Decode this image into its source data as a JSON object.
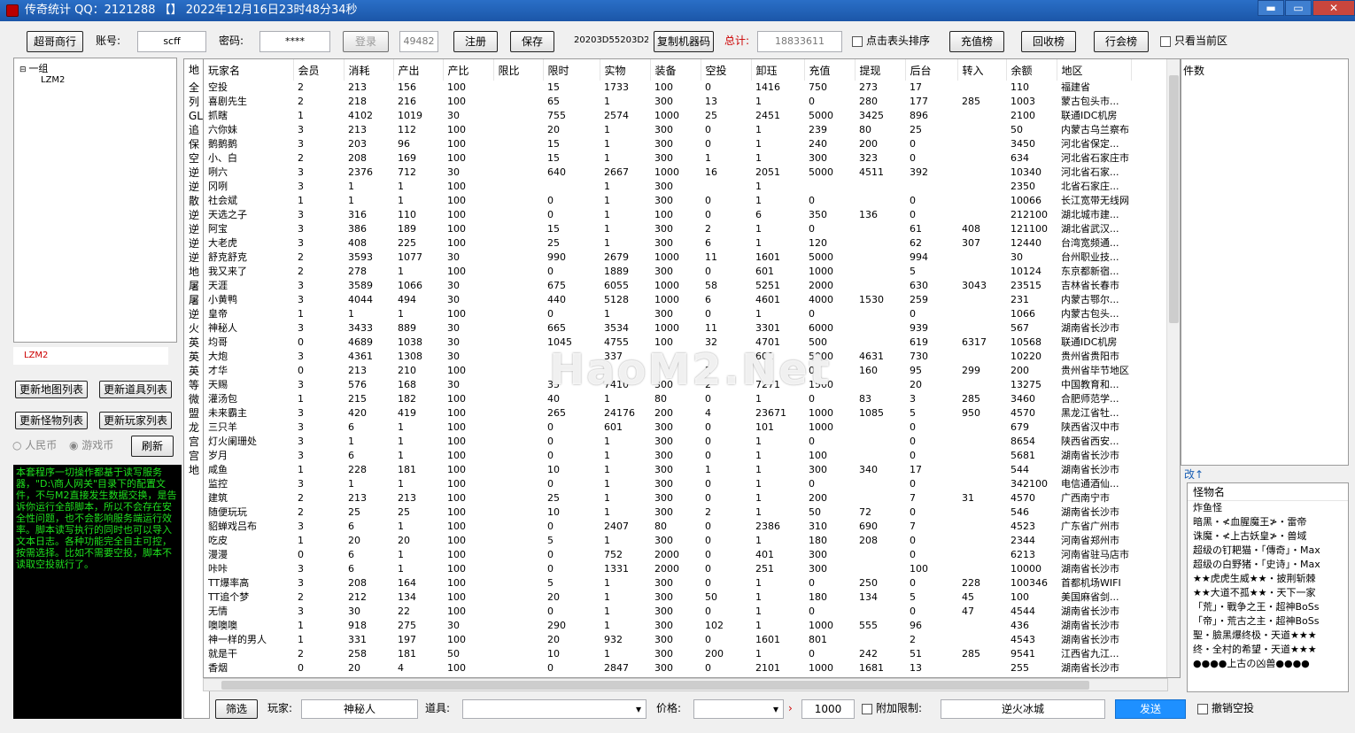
{
  "window": {
    "title": "传奇统计 QQ：2121288 【】 2022年12月16日23时48分34秒",
    "min": "▬",
    "max": "▭",
    "close": "✕"
  },
  "toolbar": {
    "mode_button": "超哥商行",
    "account_label": "账号:",
    "account_value": "scff",
    "password_label": "密码:",
    "password_value": "****",
    "login": "登录",
    "port": "49482",
    "register": "注册",
    "save": "保存",
    "machine_code": "20203D55203D2",
    "copy_machine_code": "复制机器码",
    "total_label": "总计:",
    "total_value": "18833611",
    "sort_by_header": "点击表头排序",
    "recharge_rank": "充值榜",
    "recycle_rank": "回收榜",
    "guild_rank": "行会榜",
    "current_area_only": "只看当前区"
  },
  "tree": {
    "group": "一组",
    "child": "LZM2"
  },
  "left": {
    "server_name": "LZM2",
    "update_map": "更新地图列表",
    "update_item": "更新道具列表",
    "update_monster": "更新怪物列表",
    "update_player": "更新玩家列表",
    "rmb_label": "人民币",
    "game_coin_label": "游戏币",
    "refresh": "刷新",
    "console_text": "本套程序一切操作都基于读写服务器，\"D:\\商人网关\"目录下的配置文件，不与M2直接发生数据交换，是告诉你运行全部脚本，所以不会存在安全性问题，也不会影响服务端运行效率。脚本读写执行的同时也可以导入文本日志。各种功能完全自主可控，按需选择。比如不需要空投，脚本不读取空投就行了。"
  },
  "maps": [
    "地",
    "全",
    "列",
    "GL",
    "追",
    "保",
    "空",
    "逆",
    "逆",
    "散",
    "逆",
    "逆",
    "逆",
    "逆",
    "地",
    "屠",
    "屠",
    "逆",
    "火",
    "英",
    "英",
    "英",
    "等",
    "微",
    "盟",
    "龙",
    "宫",
    "宫",
    "地"
  ],
  "headers": [
    "玩家名",
    "会员",
    "消耗",
    "产出",
    "产比",
    "限比",
    "限时",
    "实物",
    "装备",
    "空投",
    "卸珏",
    "充值",
    "提现",
    "后台",
    "转入",
    "余额",
    "地区"
  ],
  "rows": [
    [
      "空投",
      "2",
      "213",
      "156",
      "100",
      "",
      "15",
      "1733",
      "100",
      "0",
      "1416",
      "750",
      "273",
      "17",
      "",
      "110",
      "福建省"
    ],
    [
      "喜剧先生",
      "2",
      "218",
      "216",
      "100",
      "",
      "65",
      "1",
      "300",
      "13",
      "1",
      "0",
      "280",
      "177",
      "285",
      "1003",
      "蒙古包头市..."
    ],
    [
      "抓瞎",
      "1",
      "4102",
      "1019",
      "30",
      "",
      "755",
      "2574",
      "1000",
      "25",
      "2451",
      "5000",
      "3425",
      "896",
      "",
      "2100",
      "联通IDC机房"
    ],
    [
      "六你妹",
      "3",
      "213",
      "112",
      "100",
      "",
      "20",
      "1",
      "300",
      "0",
      "1",
      "239",
      "80",
      "25",
      "",
      "50",
      "内蒙古乌兰察布"
    ],
    [
      "鹅鹅鹅",
      "3",
      "203",
      "96",
      "100",
      "",
      "15",
      "1",
      "300",
      "0",
      "1",
      "240",
      "200",
      "0",
      "",
      "3450",
      "河北省保定..."
    ],
    [
      "小、白",
      "2",
      "208",
      "169",
      "100",
      "",
      "15",
      "1",
      "300",
      "1",
      "1",
      "300",
      "323",
      "0",
      "",
      "634",
      "河北省石家庄市"
    ],
    [
      "咧六",
      "3",
      "2376",
      "712",
      "30",
      "",
      "640",
      "2667",
      "1000",
      "16",
      "2051",
      "5000",
      "4511",
      "392",
      "",
      "10340",
      "河北省石家..."
    ],
    [
      "冈咧",
      "3",
      "1",
      "1",
      "100",
      "",
      "",
      "1",
      "300",
      "",
      "1",
      "",
      "",
      "",
      "",
      "2350",
      "北省石家庄..."
    ],
    [
      "社会斌",
      "1",
      "1",
      "1",
      "100",
      "",
      "0",
      "1",
      "300",
      "0",
      "1",
      "0",
      "",
      "0",
      "",
      "10066",
      "长江宽带无线网"
    ],
    [
      "天选之子",
      "3",
      "316",
      "110",
      "100",
      "",
      "0",
      "1",
      "100",
      "0",
      "6",
      "350",
      "136",
      "0",
      "",
      "212100",
      "湖北城市建..."
    ],
    [
      "阿宝",
      "3",
      "386",
      "189",
      "100",
      "",
      "15",
      "1",
      "300",
      "2",
      "1",
      "0",
      "",
      "61",
      "408",
      "121100",
      "湖北省武汉..."
    ],
    [
      "大老虎",
      "3",
      "408",
      "225",
      "100",
      "",
      "25",
      "1",
      "300",
      "6",
      "1",
      "120",
      "",
      "62",
      "307",
      "12440",
      "台湾宽频通..."
    ],
    [
      "舒克舒克",
      "2",
      "3593",
      "1077",
      "30",
      "",
      "990",
      "2679",
      "1000",
      "11",
      "1601",
      "5000",
      "",
      "994",
      "",
      "30",
      "台州职业技..."
    ],
    [
      "我又来了",
      "2",
      "278",
      "1",
      "100",
      "",
      "0",
      "1889",
      "300",
      "0",
      "601",
      "1000",
      "",
      "5",
      "",
      "10124",
      "东京都新宿..."
    ],
    [
      "天涯",
      "3",
      "3589",
      "1066",
      "30",
      "",
      "675",
      "6055",
      "1000",
      "58",
      "5251",
      "2000",
      "",
      "630",
      "3043",
      "23515",
      "吉林省长春市"
    ],
    [
      "小黄鸭",
      "3",
      "4044",
      "494",
      "30",
      "",
      "440",
      "5128",
      "1000",
      "6",
      "4601",
      "4000",
      "1530",
      "259",
      "",
      "231",
      "内蒙古鄂尔..."
    ],
    [
      "皇帝",
      "1",
      "1",
      "1",
      "100",
      "",
      "0",
      "1",
      "300",
      "0",
      "1",
      "0",
      "",
      "0",
      "",
      "1066",
      "内蒙古包头..."
    ],
    [
      "神秘人",
      "3",
      "3433",
      "889",
      "30",
      "",
      "665",
      "3534",
      "1000",
      "11",
      "3301",
      "6000",
      "",
      "939",
      "",
      "567",
      "湖南省长沙市"
    ],
    [
      "均哥",
      "0",
      "4689",
      "1038",
      "30",
      "",
      "1045",
      "4755",
      "100",
      "32",
      "4701",
      "500",
      "",
      "619",
      "6317",
      "10568",
      "联通IDC机房"
    ],
    [
      "大炮",
      "3",
      "4361",
      "1308",
      "30",
      "",
      "",
      "337",
      "",
      "",
      "601",
      "5000",
      "4631",
      "730",
      "",
      "10220",
      "贵州省贵阳市"
    ],
    [
      "才华",
      "0",
      "213",
      "210",
      "100",
      "",
      "",
      "",
      "",
      "2",
      "",
      "0",
      "160",
      "95",
      "299",
      "200",
      "贵州省毕节地区"
    ],
    [
      "天赐",
      "3",
      "576",
      "168",
      "30",
      "",
      "35",
      "7410",
      "300",
      "2",
      "7271",
      "1500",
      "",
      "20",
      "",
      "13275",
      "中国教育和..."
    ],
    [
      "灌汤包",
      "1",
      "215",
      "182",
      "100",
      "",
      "40",
      "1",
      "80",
      "0",
      "1",
      "0",
      "83",
      "3",
      "285",
      "3460",
      "合肥师范学..."
    ],
    [
      "未来霸主",
      "3",
      "420",
      "419",
      "100",
      "",
      "265",
      "24176",
      "200",
      "4",
      "23671",
      "1000",
      "1085",
      "5",
      "950",
      "4570",
      "黑龙江省牡..."
    ],
    [
      "三只羊",
      "3",
      "6",
      "1",
      "100",
      "",
      "0",
      "601",
      "300",
      "0",
      "101",
      "1000",
      "",
      "0",
      "",
      "679",
      "陕西省汉中市"
    ],
    [
      "灯火阑珊处",
      "3",
      "1",
      "1",
      "100",
      "",
      "0",
      "1",
      "300",
      "0",
      "1",
      "0",
      "",
      "0",
      "",
      "8654",
      "陕西省西安..."
    ],
    [
      "岁月",
      "3",
      "6",
      "1",
      "100",
      "",
      "0",
      "1",
      "300",
      "0",
      "1",
      "100",
      "",
      "0",
      "",
      "5681",
      "湖南省长沙市"
    ],
    [
      "咸鱼",
      "1",
      "228",
      "181",
      "100",
      "",
      "10",
      "1",
      "300",
      "1",
      "1",
      "300",
      "340",
      "17",
      "",
      "544",
      "湖南省长沙市"
    ],
    [
      "监控",
      "3",
      "1",
      "1",
      "100",
      "",
      "0",
      "1",
      "300",
      "0",
      "1",
      "0",
      "",
      "0",
      "",
      "342100",
      "电信通酒仙..."
    ],
    [
      "建筑",
      "2",
      "213",
      "213",
      "100",
      "",
      "25",
      "1",
      "300",
      "0",
      "1",
      "200",
      "",
      "7",
      "31",
      "4570",
      "广西南宁市"
    ],
    [
      "随便玩玩",
      "2",
      "25",
      "25",
      "100",
      "",
      "10",
      "1",
      "300",
      "2",
      "1",
      "50",
      "72",
      "0",
      "",
      "546",
      "湖南省长沙市"
    ],
    [
      "貂蝉戏吕布",
      "3",
      "6",
      "1",
      "100",
      "",
      "0",
      "2407",
      "80",
      "0",
      "2386",
      "310",
      "690",
      "7",
      "",
      "4523",
      "广东省广州市"
    ],
    [
      "吃皮",
      "1",
      "20",
      "20",
      "100",
      "",
      "5",
      "1",
      "300",
      "0",
      "1",
      "180",
      "208",
      "0",
      "",
      "2344",
      "河南省郑州市"
    ],
    [
      "漫漫",
      "0",
      "6",
      "1",
      "100",
      "",
      "0",
      "752",
      "2000",
      "0",
      "401",
      "300",
      "",
      "0",
      "",
      "6213",
      "河南省驻马店市"
    ],
    [
      "咔咔",
      "3",
      "6",
      "1",
      "100",
      "",
      "0",
      "1331",
      "2000",
      "0",
      "251",
      "300",
      "",
      "100",
      "",
      "10000",
      "湖南省长沙市"
    ],
    [
      "TT爆率高",
      "3",
      "208",
      "164",
      "100",
      "",
      "5",
      "1",
      "300",
      "0",
      "1",
      "0",
      "250",
      "0",
      "228",
      "100346",
      "首都机场WIFI"
    ],
    [
      "TT追个梦",
      "2",
      "212",
      "134",
      "100",
      "",
      "20",
      "1",
      "300",
      "50",
      "1",
      "180",
      "134",
      "5",
      "45",
      "100",
      "美国麻省剑..."
    ],
    [
      "无情",
      "3",
      "30",
      "22",
      "100",
      "",
      "0",
      "1",
      "300",
      "0",
      "1",
      "0",
      "",
      "0",
      "47",
      "4544",
      "湖南省长沙市"
    ],
    [
      "噢噢噢",
      "1",
      "918",
      "275",
      "30",
      "",
      "290",
      "1",
      "300",
      "102",
      "1",
      "1000",
      "555",
      "96",
      "",
      "436",
      "湖南省长沙市"
    ],
    [
      "神一样的男人",
      "1",
      "331",
      "197",
      "100",
      "",
      "20",
      "932",
      "300",
      "0",
      "1601",
      "801",
      "",
      "2",
      "",
      "4543",
      "湖南省长沙市"
    ],
    [
      "就是干",
      "2",
      "258",
      "181",
      "50",
      "",
      "10",
      "1",
      "300",
      "200",
      "1",
      "0",
      "242",
      "51",
      "285",
      "9541",
      "江西省九江..."
    ],
    [
      "香烟",
      "0",
      "20",
      "4",
      "100",
      "",
      "0",
      "2847",
      "300",
      "0",
      "2101",
      "1000",
      "1681",
      "13",
      "",
      "255",
      "湖南省长沙市"
    ]
  ],
  "right": {
    "header": "件数",
    "change_link": "改↑"
  },
  "monsters": {
    "header": "怪物名",
    "items": [
      "炸鱼怪",
      "暗黑・≮血腥魔王≯・雷帝",
      "诛魔・≮上古妖皇≯・兽域",
      "超级の钉耙猫・「傳奇」・Max",
      "超级の白野猪・「史诗」・Max",
      "★★虎虎生威★★・披荆斩棘",
      "★★大道不孤★★・天下一家",
      "「荒」・戰争之王・超神BoSs",
      "「帝」・荒古之主・超神BoSs",
      "聖・臉黑爆终极・天道★★★",
      "终・全村的希望・天道★★★",
      "●●●●上古の凶兽●●●●"
    ]
  },
  "bottom": {
    "filter": "筛选",
    "player_label": "玩家:",
    "player_value": "神秘人",
    "item_label": "道具:",
    "price_label": "价格:",
    "quantity": "1000",
    "extra_limit": "附加限制:",
    "map_value": "逆火冰城",
    "send": "发送",
    "cancel_airdrop": "撤销空投"
  },
  "watermark": "HaoM2.Net",
  "colors": {
    "title_bar": "#1b56a8",
    "send_button": "#1e90ff",
    "console_text": "#1ee01e",
    "total_label": "#cc0000"
  }
}
